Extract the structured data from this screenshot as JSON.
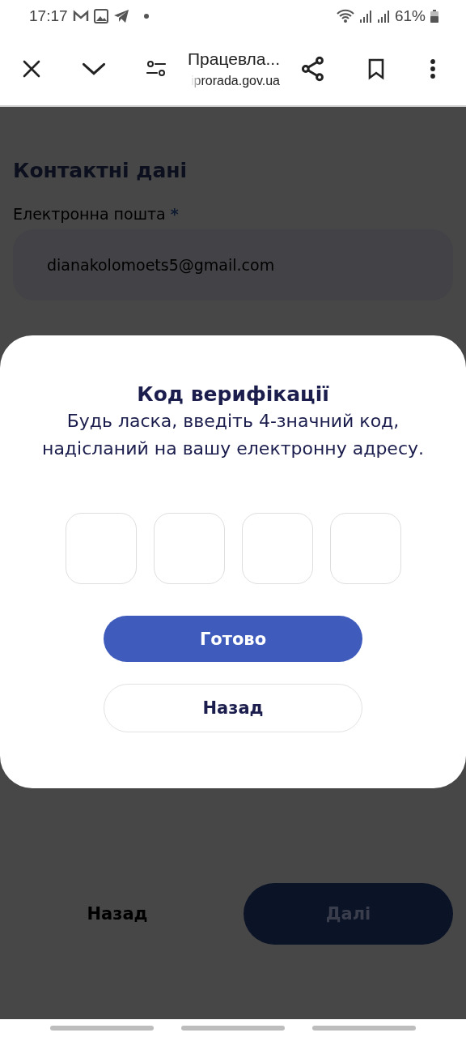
{
  "status_bar": {
    "time": "17:17",
    "battery": "61%"
  },
  "browser": {
    "title": "Працевла...",
    "url": "iprorada.gov.ua"
  },
  "page": {
    "heading": "Контактні дані",
    "email_field": {
      "label": "Електронна пошта",
      "required_mark": "*",
      "value": "dianakolomoets5@gmail.com"
    },
    "buttons": [
      {
        "label": "Назад",
        "kind": "text",
        "disabled": false
      },
      {
        "label": "Далі",
        "kind": "primary",
        "disabled": true
      }
    ]
  },
  "dialog": {
    "title": "Код верифікації",
    "message": "Будь ласка, введіть 4-значний код, надісланий на вашу електронну адресу.",
    "code_fields": [
      {
        "kind": "digit"
      },
      {
        "kind": "digit"
      },
      {
        "kind": "digit"
      },
      {
        "kind": "digit"
      }
    ],
    "buttons": [
      {
        "label": "Готово",
        "kind": "primary"
      },
      {
        "label": "Назад",
        "kind": "outline"
      }
    ]
  }
}
